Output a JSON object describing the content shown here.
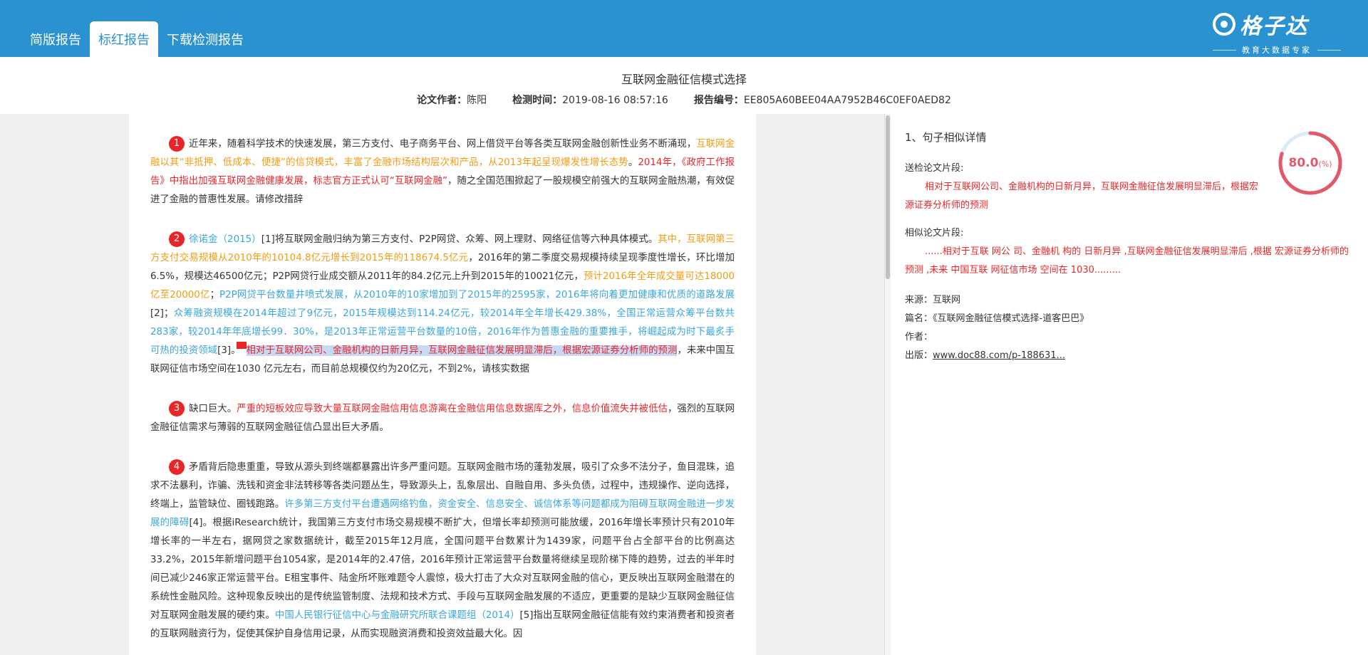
{
  "tabs": [
    "简版报告",
    "标红报告",
    "下载检测报告"
  ],
  "logo": {
    "text": "格子达",
    "subtitle": "教育大数据专家"
  },
  "title": "互联网金融征信模式选择",
  "meta": {
    "author_label": "论文作者：",
    "author": "陈阳",
    "time_label": "检测时间：",
    "time": "2019-08-16 08:57:16",
    "id_label": "报告编号：",
    "id": "EE805A60BEE04AA7952B46C0EF0AED82"
  },
  "doc": {
    "p1": {
      "num": "1",
      "a": "近年来，随着科学技术的快速发展，第三方支付、电子商务平台、网上借贷平台等各类互联网金融创新性业务不断涌现，",
      "b": "互联网金融以其“非抵押、低成本、便捷”的信贷模式，丰富了金融市场结构层次和产品，从2013年起呈现爆发性增长态势",
      "c": "。",
      "d": "2014年，《政府工作报告》中指出加强互联网金融健康发展，标志官方正式认可“互联网金融”",
      "e": "，随之全国范围掀起了一股规模空前强大的互联网金融热潮，有效促进了金融的普惠性发展。请修改措辞"
    },
    "p2": {
      "num": "2",
      "a": "徐诺金（2015）",
      "b": "[1]将互联网金融归纳为第三方支付、P2P网贷、众筹、网上理财、网络征信等六种具体模式。",
      "c": "其中，互联网第三方支付交易规模从2010年的10104.8亿元增长到2015年的118674.5亿元",
      "d": "，2016年的第二季度交易规模持续呈现季度性增长，环比增加6.5%，规模达46500亿元；P2P网贷行业成交额从2011年的84.2亿元上升到2015年的10021亿元，",
      "e": "预计2016年全年成交量可达18000亿至20000亿",
      "f": "；",
      "g": "P2P网贷平台数量井喷式发展，从2010年的10家增加到了2015年的2595家，2016年将向着更加健康和优质的道路发展",
      "h": "[2]；",
      "i": "众筹融资规模在2014年超过了9亿元，2015年规模达到114.24亿元，较2014年全年增长429.38%，全国正常运营众筹平台数共283家，较2014年年底增长99．30%，是2013年正常运营平台数量的10倍，2016年作为普惠金融的重要推手，将崛起成为时下最炙手可热的投资领域",
      "j": "[3]。",
      "k": "相对于互联网公司、金融机构的日新月异，互联网金融征信发展明显滞后，根据宏源证券分析师的预测",
      "l": "，未来中国互联网征信市场空间在1030 亿元左右，而目前总规模仅约为20亿元，不到2%，请核实数据"
    },
    "p3": {
      "num": "3",
      "a": "缺口巨大。",
      "b": "严重的短板效应导致大量互联网金融信用信息游离在金融信用信息数据库之外，信息价值流失并被低估",
      "c": "，强烈的互联网金融征信需求与薄弱的互联网金融征信凸显出巨大矛盾。"
    },
    "p4": {
      "num": "4",
      "a": "矛盾背后隐患重重，导致从源头到终端都暴露出许多严重问题。互联网金融市场的蓬勃发展，吸引了众多不法分子，鱼目混珠，追求不法暴利，诈骗、洗钱和资金非法转移等各类问题丛生，导致源头上，乱象层出、自融自用、多头负债，过程中，违规操作、逆向选择，终端上，监管缺位、圈钱跑路。",
      "b": "许多第三方支付平台遭遇网络钓鱼，资金安全、信息安全、诚信体系等问题都成为阻碍互联网金融进一步发展的障碍",
      "c": "[4]。根据iResearch统计，我国第三方支付市场交易规模不断扩大，但增长率却预测可能放缓，2016年增长率预计只有2010年增长率的一半左右，据网贷之家数据统计，截至2015年12月底，全国问题平台数累计为1439家，问题平台占全部平台的比例高达33.2%，2015年新增问题平台1054家，是2014年的2.47倍，2016年预计正常运营平台数量将继续呈现阶梯下降的趋势，过去的半年时间已减少246家正常运营平台。E租宝事件、陆金所坏账难题令人震惊，极大打击了大众对互联网金融的信心，更反映出互联网金融潜在的系统性金融风险。这种现象反映出的是传统监管制度、法规和技术方式、手段与互联网金融发展的不适应，更重要的是缺少互联网金融征信对互联网金融发展的硬约束。",
      "d": "中国人民银行征信中心与金融研究所联合课题组（2014）",
      "e": "[5]指出互联网金融征信能有效约束消费者和投资者的互联网融资行为，促使其保护自身信用记录，从而实现融资消费和投资效益最大化。因"
    }
  },
  "panel": {
    "title": "1、句子相似详情",
    "score": "80.0",
    "score_unit": "(%)",
    "score_value": 0.8,
    "submitted_label": "送检论文片段:",
    "submitted_text": "相对于互联网公司、金融机构的日新月异，互联网金融征信发展明显滞后，根据宏源证券分析师的预测",
    "similar_label": "相似论文片段:",
    "similar_text": "......相对于互联 网公 司、金融机 构的 日新月异 ,互联网金融征信发展明显滞后 ,根据 宏源证券分析师的预测 ,未来 中国互联 网征信市场 空间在 1030.........",
    "source_label": "来源：",
    "source": "互联网",
    "name_label": "篇名：",
    "name": "《互联网金融征信模式选择-道客巴巴》",
    "author_label": "作者：",
    "author": "",
    "pub_label": "出版：",
    "pub": "www.doc88.com/p-188631..."
  },
  "colors": {
    "header": "#2a92d0",
    "red": "#e8262a",
    "orange": "#f39c12",
    "blue": "#3aa6de",
    "gauge": "#e05a6a"
  }
}
